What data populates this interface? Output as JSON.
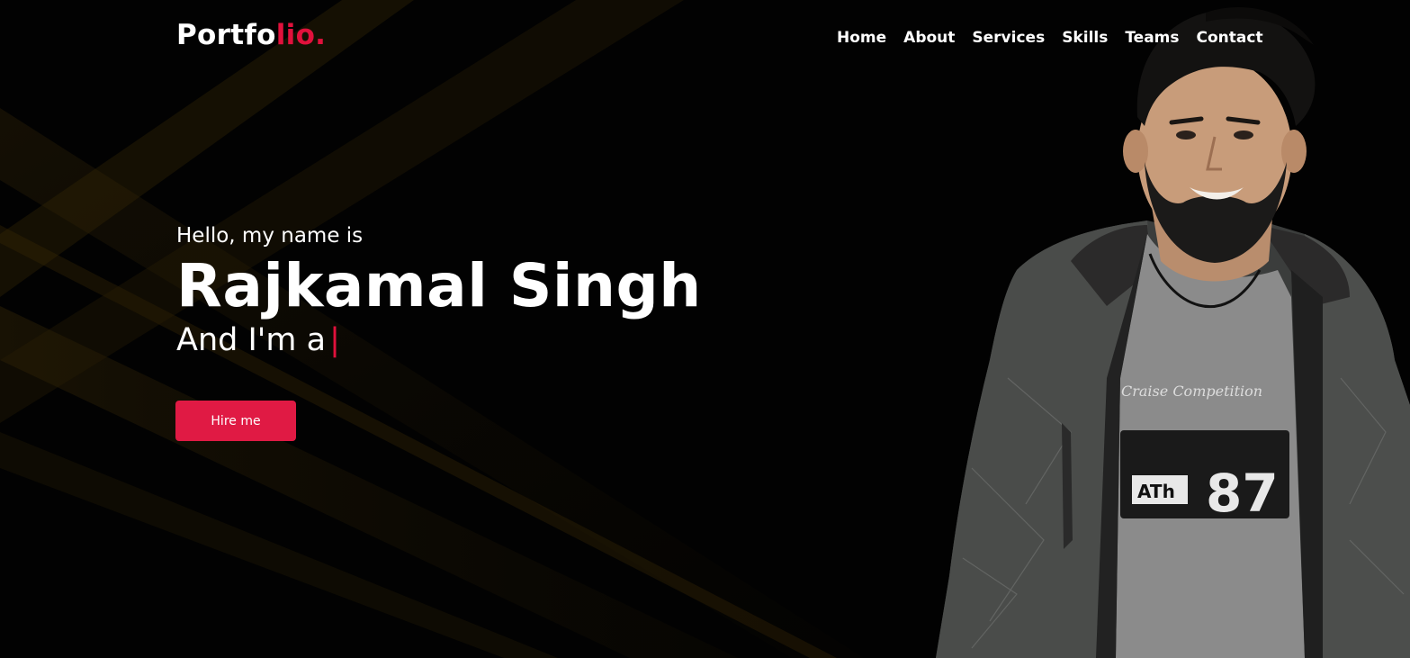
{
  "brand": {
    "logo_main": "Portfo",
    "logo_accent": "lio."
  },
  "nav": {
    "items": [
      "Home",
      "About",
      "Services",
      "Skills",
      "Teams",
      "Contact"
    ]
  },
  "hero": {
    "greeting": "Hello, my name is",
    "name": "Rajkamal Singh",
    "role_prefix": "And I'm a",
    "cursor": "|",
    "cta_label": "Hire me"
  },
  "colors": {
    "accent": "#e1113c",
    "background": "#000000",
    "text": "#ffffff"
  },
  "icons": {
    "profile_photo": "portrait-photo"
  }
}
